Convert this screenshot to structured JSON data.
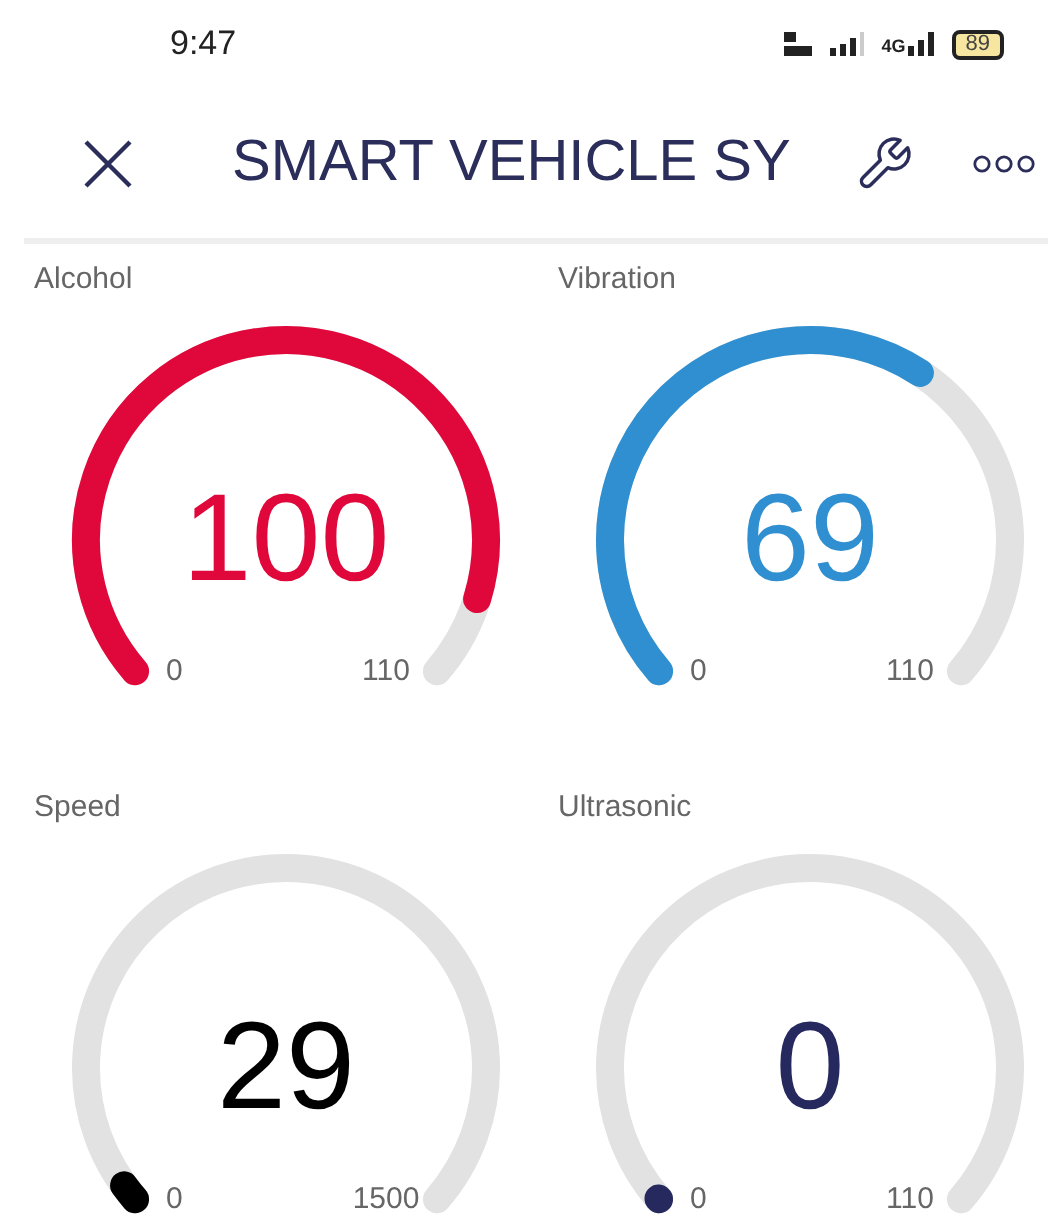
{
  "status_bar": {
    "time": "9:47",
    "network_type": "4G",
    "battery": "89"
  },
  "header": {
    "title": "SMART VEHICLE SY"
  },
  "gauges": [
    {
      "label": "Alcohol",
      "value": "100",
      "min": "0",
      "max": "110",
      "color": "#e0073b"
    },
    {
      "label": "Vibration",
      "value": "69",
      "min": "0",
      "max": "110",
      "color": "#2f8fd0"
    },
    {
      "label": "Speed",
      "value": "29",
      "min": "0",
      "max": "1500",
      "color": "#000000"
    },
    {
      "label": "Ultrasonic",
      "value": "0",
      "min": "0",
      "max": "110",
      "color": "#25295e"
    }
  ]
}
